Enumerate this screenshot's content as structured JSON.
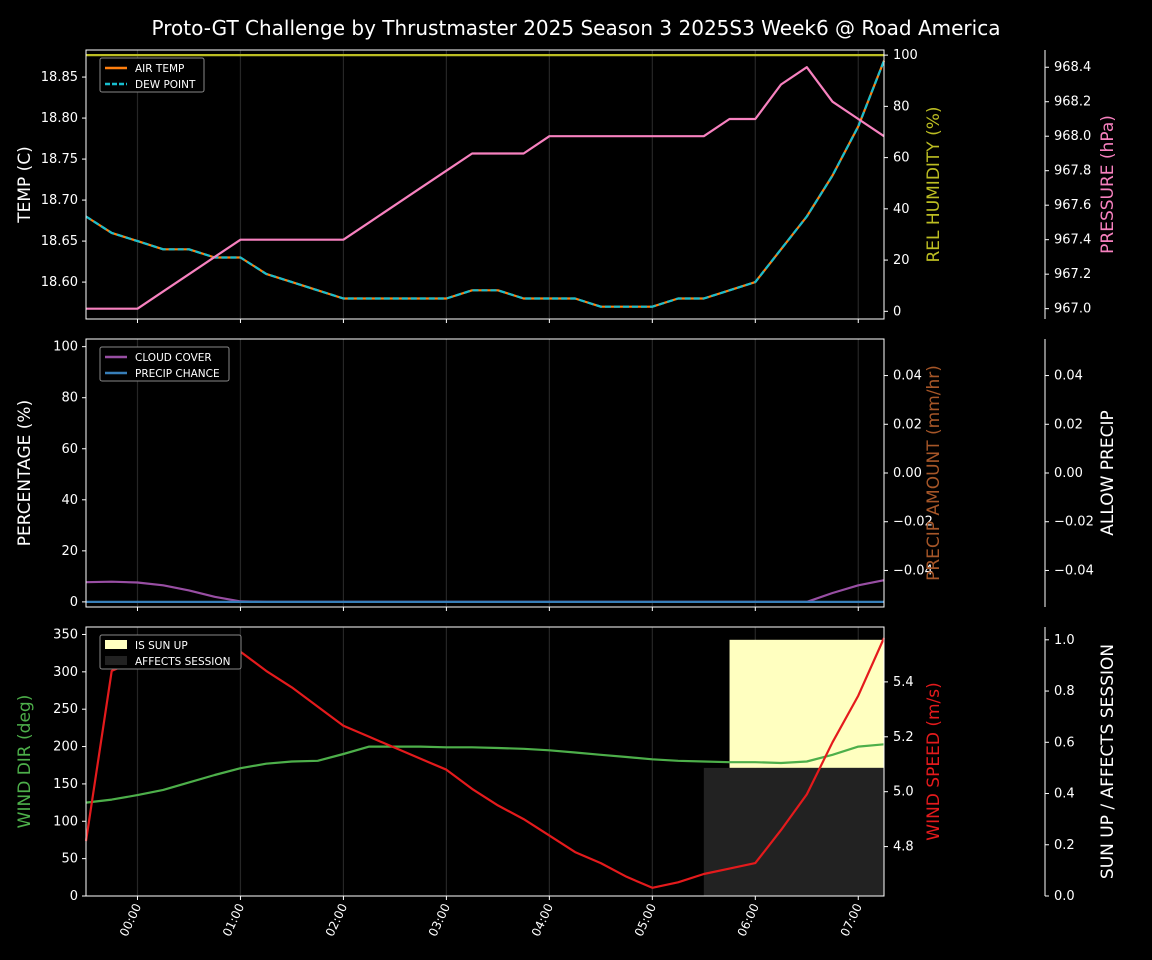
{
  "title": "Proto-GT Challenge by Thrustmaster 2025 Season 3 2025S3 Week6 @ Road America",
  "colors": {
    "background": "#000000",
    "air_temp": "#ff7f0e",
    "dew_point": "#17becf",
    "humidity": "#bcbd22",
    "pressure": "#f781bf",
    "cloud_cover": "#984ea3",
    "precip_chance": "#377eb8",
    "precip_amount": "#a65628",
    "wind_dir": "#4daf4a",
    "wind_speed": "#e41a1c",
    "sun_up": "#ffffc0",
    "affects_session": "#222222"
  },
  "x_time_ticks": [
    "00:00",
    "01:00",
    "02:00",
    "03:00",
    "04:00",
    "05:00",
    "06:00",
    "07:00"
  ],
  "chart_data": [
    {
      "type": "line",
      "panel": "temperature-humidity-pressure",
      "x_unit": "hours from 00:00",
      "xlim": [
        -0.5,
        7.25
      ],
      "ylabel": "TEMP (C)",
      "ylim": [
        18.555,
        18.883
      ],
      "yticks": [
        "18.60",
        "18.65",
        "18.70",
        "18.75",
        "18.80",
        "18.85"
      ],
      "ylabel_right": "REL HUMIDITY (%)",
      "ylim_right": [
        -3,
        102
      ],
      "yticks_right": [
        "0",
        "20",
        "40",
        "60",
        "80",
        "100"
      ],
      "ylabel_far_right": "PRESSURE (hPa)",
      "ylim_far_right": [
        966.94,
        968.5
      ],
      "yticks_far_right": [
        "967.0",
        "967.2",
        "967.4",
        "967.6",
        "967.8",
        "968.0",
        "968.2",
        "968.4"
      ],
      "legend": [
        "AIR TEMP",
        "DEW POINT"
      ],
      "legend_position": "upper-left",
      "grid": "vertical",
      "x": [
        -0.5,
        -0.25,
        0.0,
        0.25,
        0.5,
        0.75,
        1.0,
        1.25,
        1.5,
        1.75,
        2.0,
        2.25,
        2.5,
        2.75,
        3.0,
        3.25,
        3.5,
        3.75,
        4.0,
        4.25,
        4.5,
        4.75,
        5.0,
        5.25,
        5.5,
        5.75,
        6.0,
        6.25,
        6.5,
        6.75,
        7.0,
        7.25
      ],
      "series": [
        {
          "name": "AIR TEMP",
          "axis": "left",
          "values": [
            18.68,
            18.66,
            18.65,
            18.64,
            18.64,
            18.63,
            18.63,
            18.61,
            18.6,
            18.59,
            18.58,
            18.58,
            18.58,
            18.58,
            18.58,
            18.59,
            18.59,
            18.58,
            18.58,
            18.58,
            18.57,
            18.57,
            18.57,
            18.58,
            18.58,
            18.59,
            18.6,
            18.64,
            18.68,
            18.73,
            18.79,
            18.87
          ]
        },
        {
          "name": "DEW POINT",
          "axis": "left",
          "values": [
            18.68,
            18.66,
            18.65,
            18.64,
            18.64,
            18.63,
            18.63,
            18.61,
            18.6,
            18.59,
            18.58,
            18.58,
            18.58,
            18.58,
            18.58,
            18.59,
            18.59,
            18.58,
            18.58,
            18.58,
            18.57,
            18.57,
            18.57,
            18.58,
            18.58,
            18.59,
            18.6,
            18.64,
            18.68,
            18.73,
            18.79,
            18.87
          ]
        },
        {
          "name": "REL HUMIDITY",
          "axis": "right",
          "values": [
            100,
            100,
            100,
            100,
            100,
            100,
            100,
            100,
            100,
            100,
            100,
            100,
            100,
            100,
            100,
            100,
            100,
            100,
            100,
            100,
            100,
            100,
            100,
            100,
            100,
            100,
            100,
            100,
            100,
            100,
            100,
            100
          ]
        },
        {
          "name": "PRESSURE",
          "axis": "far_right",
          "values": [
            967.0,
            967.0,
            967.0,
            967.1,
            967.2,
            967.3,
            967.4,
            967.4,
            967.4,
            967.4,
            967.4,
            967.5,
            967.6,
            967.7,
            967.8,
            967.9,
            967.9,
            967.9,
            968.0,
            968.0,
            968.0,
            968.0,
            968.0,
            968.0,
            968.0,
            968.1,
            968.1,
            968.3,
            968.4,
            968.2,
            968.1,
            968.0
          ]
        }
      ]
    },
    {
      "type": "line",
      "panel": "clouds-precip",
      "x_unit": "hours from 00:00",
      "xlim": [
        -0.5,
        7.25
      ],
      "ylabel": "PERCENTAGE (%)",
      "ylim": [
        -2,
        103
      ],
      "yticks": [
        "0",
        "20",
        "40",
        "60",
        "80",
        "100"
      ],
      "ylabel_right": "PRECIP AMOUNT (mm/hr)",
      "ylim_right": [
        -0.055,
        0.055
      ],
      "yticks_right": [
        "−0.04",
        "−0.02",
        "0.00",
        "0.02",
        "0.04"
      ],
      "ylabel_far_right": "ALLOW PRECIP",
      "ylim_far_right": [
        -0.055,
        0.055
      ],
      "yticks_far_right": [
        "−0.04",
        "−0.02",
        "0.00",
        "0.02",
        "0.04"
      ],
      "legend": [
        "CLOUD COVER",
        "PRECIP CHANCE"
      ],
      "legend_position": "upper-left",
      "grid": "vertical",
      "x": [
        -0.5,
        -0.25,
        0.0,
        0.25,
        0.5,
        0.75,
        1.0,
        1.25,
        1.5,
        1.75,
        2.0,
        2.25,
        2.5,
        2.75,
        3.0,
        3.25,
        3.5,
        3.75,
        4.0,
        4.25,
        4.5,
        4.75,
        5.0,
        5.25,
        5.5,
        5.75,
        6.0,
        6.25,
        6.5,
        6.75,
        7.0,
        7.25
      ],
      "series": [
        {
          "name": "CLOUD COVER",
          "values": [
            7.7,
            7.9,
            7.6,
            6.5,
            4.5,
            2.0,
            0.2,
            0,
            0,
            0,
            0,
            0,
            0,
            0,
            0,
            0,
            0,
            0,
            0,
            0,
            0,
            0,
            0,
            0,
            0,
            0,
            0,
            0,
            0,
            3.5,
            6.5,
            8.5
          ]
        },
        {
          "name": "PRECIP CHANCE",
          "values": [
            0,
            0,
            0,
            0,
            0,
            0,
            0,
            0,
            0,
            0,
            0,
            0,
            0,
            0,
            0,
            0,
            0,
            0,
            0,
            0,
            0,
            0,
            0,
            0,
            0,
            0,
            0,
            0,
            0,
            0,
            0,
            0
          ]
        }
      ]
    },
    {
      "type": "line",
      "panel": "wind-sun",
      "x_unit": "hours from 00:00",
      "xlim": [
        -0.5,
        7.25
      ],
      "ylabel": "WIND DIR (deg)",
      "ylim": [
        0,
        360
      ],
      "yticks": [
        "0",
        "50",
        "100",
        "150",
        "200",
        "250",
        "300",
        "350"
      ],
      "ylabel_right": "WIND SPEED (m/s)",
      "ylim_right": [
        4.62,
        5.6
      ],
      "yticks_right": [
        "4.8",
        "5.0",
        "5.2",
        "5.4"
      ],
      "ylabel_far_right": "SUN UP / AFFECTS SESSION",
      "ylim_far_right": [
        0,
        1.05
      ],
      "yticks_far_right": [
        "0.0",
        "0.2",
        "0.4",
        "0.6",
        "0.8",
        "1.0"
      ],
      "legend": [
        "IS SUN UP",
        "AFFECTS SESSION"
      ],
      "legend_position": "upper-left",
      "grid": "vertical",
      "x": [
        -0.5,
        -0.25,
        0.0,
        0.25,
        0.5,
        0.75,
        1.0,
        1.25,
        1.5,
        1.75,
        2.0,
        2.25,
        2.5,
        2.75,
        3.0,
        3.25,
        3.5,
        3.75,
        4.0,
        4.25,
        4.5,
        4.75,
        5.0,
        5.25,
        5.5,
        5.75,
        6.0,
        6.25,
        6.5,
        6.75,
        7.0,
        7.25
      ],
      "series": [
        {
          "name": "WIND DIR",
          "axis": "left",
          "values": [
            125,
            129,
            135,
            142,
            152,
            162,
            171,
            177,
            180,
            181,
            190,
            200,
            200,
            200,
            199,
            199,
            198,
            197,
            195,
            192,
            189,
            186,
            183,
            181,
            180,
            179,
            179,
            178,
            180,
            189,
            200,
            203
          ]
        },
        {
          "name": "WIND SPEED",
          "axis": "right",
          "values": [
            4.82,
            5.44,
            5.48,
            5.51,
            5.51,
            5.51,
            5.51,
            5.44,
            5.38,
            5.31,
            5.24,
            5.2,
            5.16,
            5.12,
            5.08,
            5.01,
            4.95,
            4.9,
            4.84,
            4.78,
            4.74,
            4.69,
            4.65,
            4.67,
            4.7,
            4.72,
            4.74,
            4.86,
            4.99,
            5.18,
            5.35,
            5.56
          ]
        }
      ],
      "bands": [
        {
          "name": "IS SUN UP",
          "x_start": 5.75,
          "x_end": 7.25,
          "value": 1.0
        },
        {
          "name": "AFFECTS SESSION",
          "x_start": 5.5,
          "x_end": 7.25,
          "value": 0.5
        }
      ]
    }
  ]
}
